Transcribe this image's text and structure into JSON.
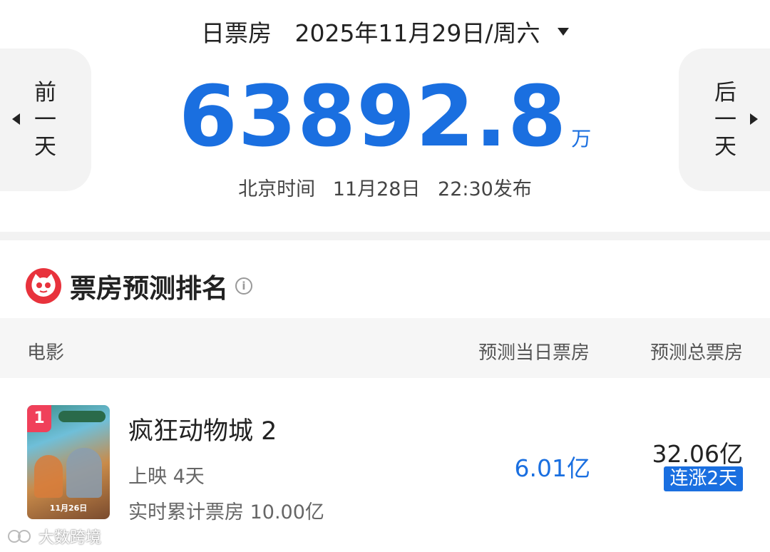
{
  "header": {
    "label": "日票房",
    "date": "2025年11月29日/周六",
    "prev_day": [
      "前",
      "一",
      "天"
    ],
    "next_day": [
      "后",
      "一",
      "天"
    ]
  },
  "summary": {
    "total": "63892.8",
    "unit": "万",
    "publish": {
      "zone": "北京时间",
      "date": "11月28日",
      "time": "22:30发布"
    }
  },
  "section": {
    "title": "票房预测排名",
    "info_icon": "info-icon",
    "logo_icon": "cat-logo-icon"
  },
  "table": {
    "headers": [
      "电影",
      "预测当日票房",
      "预测总票房"
    ],
    "rows": [
      {
        "rank": "1",
        "title": "疯狂动物城 2",
        "days_showing": "上映 4天",
        "cumulative": "实时累计票房 10.00亿",
        "predicted_day": "6.01亿",
        "predicted_total": "32.06亿",
        "badge": "连涨2天",
        "poster_date": "11月26日"
      }
    ]
  },
  "watermark": "大数跨境",
  "colors": {
    "accent": "#1a6fe0",
    "brand_red": "#e8323c",
    "rank_badge": "#f0405a"
  }
}
